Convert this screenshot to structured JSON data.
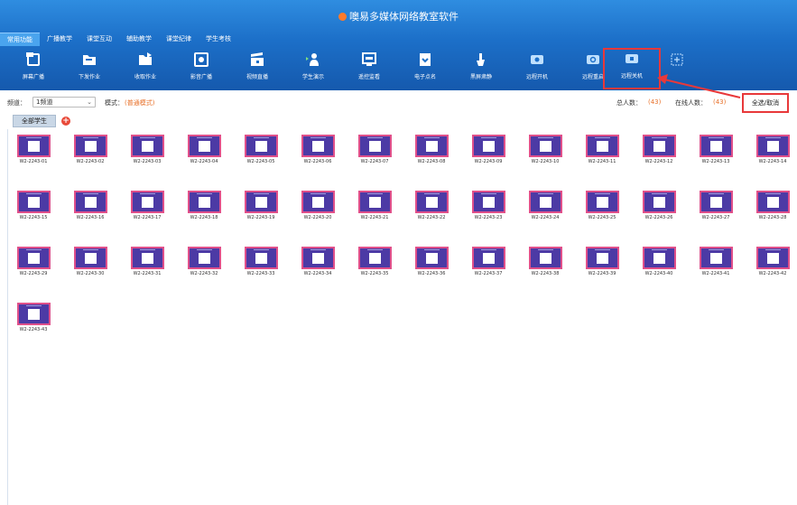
{
  "app": {
    "title": "噢易多媒体网络教室软件"
  },
  "tabs": [
    {
      "label": "常用功能",
      "active": true
    },
    {
      "label": "广播教学",
      "active": false
    },
    {
      "label": "课堂互动",
      "active": false
    },
    {
      "label": "辅助教学",
      "active": false
    },
    {
      "label": "课堂纪律",
      "active": false
    },
    {
      "label": "学生考核",
      "active": false
    }
  ],
  "toolbar": [
    {
      "label": "屏幕广播",
      "icon": "screen-broadcast-icon"
    },
    {
      "label": "下发作业",
      "icon": "send-homework-icon"
    },
    {
      "label": "收取作业",
      "icon": "collect-homework-icon"
    },
    {
      "label": "影音广播",
      "icon": "media-broadcast-icon"
    },
    {
      "label": "视频直播",
      "icon": "video-live-icon"
    },
    {
      "label": "学生演示",
      "icon": "student-demo-icon"
    },
    {
      "label": "遥控监看",
      "icon": "remote-monitor-icon"
    },
    {
      "label": "电子点名",
      "icon": "roll-call-icon"
    },
    {
      "label": "黑屏肃静",
      "icon": "black-screen-icon"
    },
    {
      "label": "远程开机",
      "icon": "remote-power-on-icon"
    },
    {
      "label": "远程重启",
      "icon": "remote-restart-icon"
    },
    {
      "label": "远程关机",
      "icon": "remote-shutdown-icon",
      "highlighted": true
    },
    {
      "label": "",
      "icon": "expand-icon"
    }
  ],
  "filter": {
    "channel_label": "频道：",
    "channel_value": "1频道",
    "mode_label": "模式：",
    "mode_value": "(普通模式)",
    "total_label": "总人数：",
    "total_value": "(43)",
    "online_label": "在线人数：",
    "online_value": "(43)",
    "select_all": "全选/取消"
  },
  "group": {
    "tab_label": "全部学生",
    "add_label": "+"
  },
  "students": [
    "W2-2243-01",
    "W2-2243-02",
    "W2-2243-03",
    "W2-2243-04",
    "W2-2243-05",
    "W2-2243-06",
    "W2-2243-07",
    "W2-2243-08",
    "W2-2243-09",
    "W2-2243-10",
    "W2-2243-11",
    "W2-2243-12",
    "W2-2243-13",
    "W2-2243-14",
    "W2-2243-15",
    "W2-2243-16",
    "W2-2243-17",
    "W2-2243-18",
    "W2-2243-19",
    "W2-2243-20",
    "W2-2243-21",
    "W2-2243-22",
    "W2-2243-23",
    "W2-2243-24",
    "W2-2243-25",
    "W2-2243-26",
    "W2-2243-27",
    "W2-2243-28",
    "W2-2243-29",
    "W2-2243-30",
    "W2-2243-31",
    "W2-2243-32",
    "W2-2243-33",
    "W2-2243-34",
    "W2-2243-35",
    "W2-2243-36",
    "W2-2243-37",
    "W2-2243-38",
    "W2-2243-39",
    "W2-2243-40",
    "W2-2243-41",
    "W2-2243-42",
    "W2-2243-43"
  ],
  "colors": {
    "header": "#1c6fc8",
    "highlight": "#e8383a",
    "screen": "#4c3aa5",
    "screen_border": "#e0508a",
    "accent": "#e8712a"
  }
}
